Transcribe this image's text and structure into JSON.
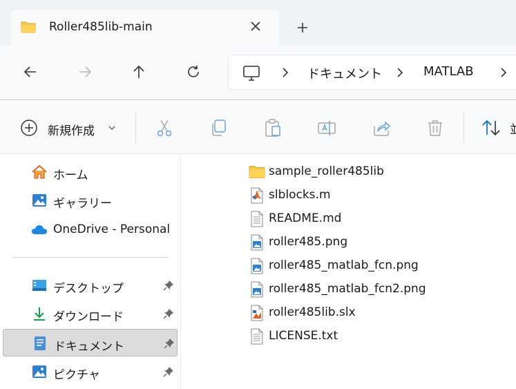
{
  "tab": {
    "title": "Roller485lib-main"
  },
  "breadcrumb": {
    "items": [
      "ドキュメント",
      "MATLAB"
    ]
  },
  "toolbar": {
    "new_label": "新規作成",
    "sort_label": "並"
  },
  "nav": {
    "items": [
      {
        "label": "ホーム",
        "icon": "home-icon"
      },
      {
        "label": "ギャラリー",
        "icon": "gallery-icon"
      },
      {
        "label": "OneDrive - Personal",
        "icon": "onedrive-cloud-icon"
      }
    ],
    "quick_access": [
      {
        "label": "デスクトップ",
        "icon": "desktop-icon",
        "pinned": true
      },
      {
        "label": "ダウンロード",
        "icon": "download-icon",
        "pinned": true
      },
      {
        "label": "ドキュメント",
        "icon": "documents-icon",
        "pinned": true,
        "selected": true
      },
      {
        "label": "ピクチャ",
        "icon": "pictures-icon",
        "pinned": true
      }
    ]
  },
  "files": [
    {
      "name": "sample_roller485lib",
      "type": "folder"
    },
    {
      "name": "slblocks.m",
      "type": "matlab-file"
    },
    {
      "name": "README.md",
      "type": "text-file"
    },
    {
      "name": "roller485.png",
      "type": "image-file"
    },
    {
      "name": "roller485_matlab_fcn.png",
      "type": "image-file"
    },
    {
      "name": "roller485_matlab_fcn2.png",
      "type": "image-file"
    },
    {
      "name": "roller485lib.slx",
      "type": "simulink-file"
    },
    {
      "name": "LICENSE.txt",
      "type": "text-file"
    }
  ],
  "colors": {
    "accent": "#0067c0",
    "folder": "#f7c948",
    "selection": "#dcdcdc"
  }
}
